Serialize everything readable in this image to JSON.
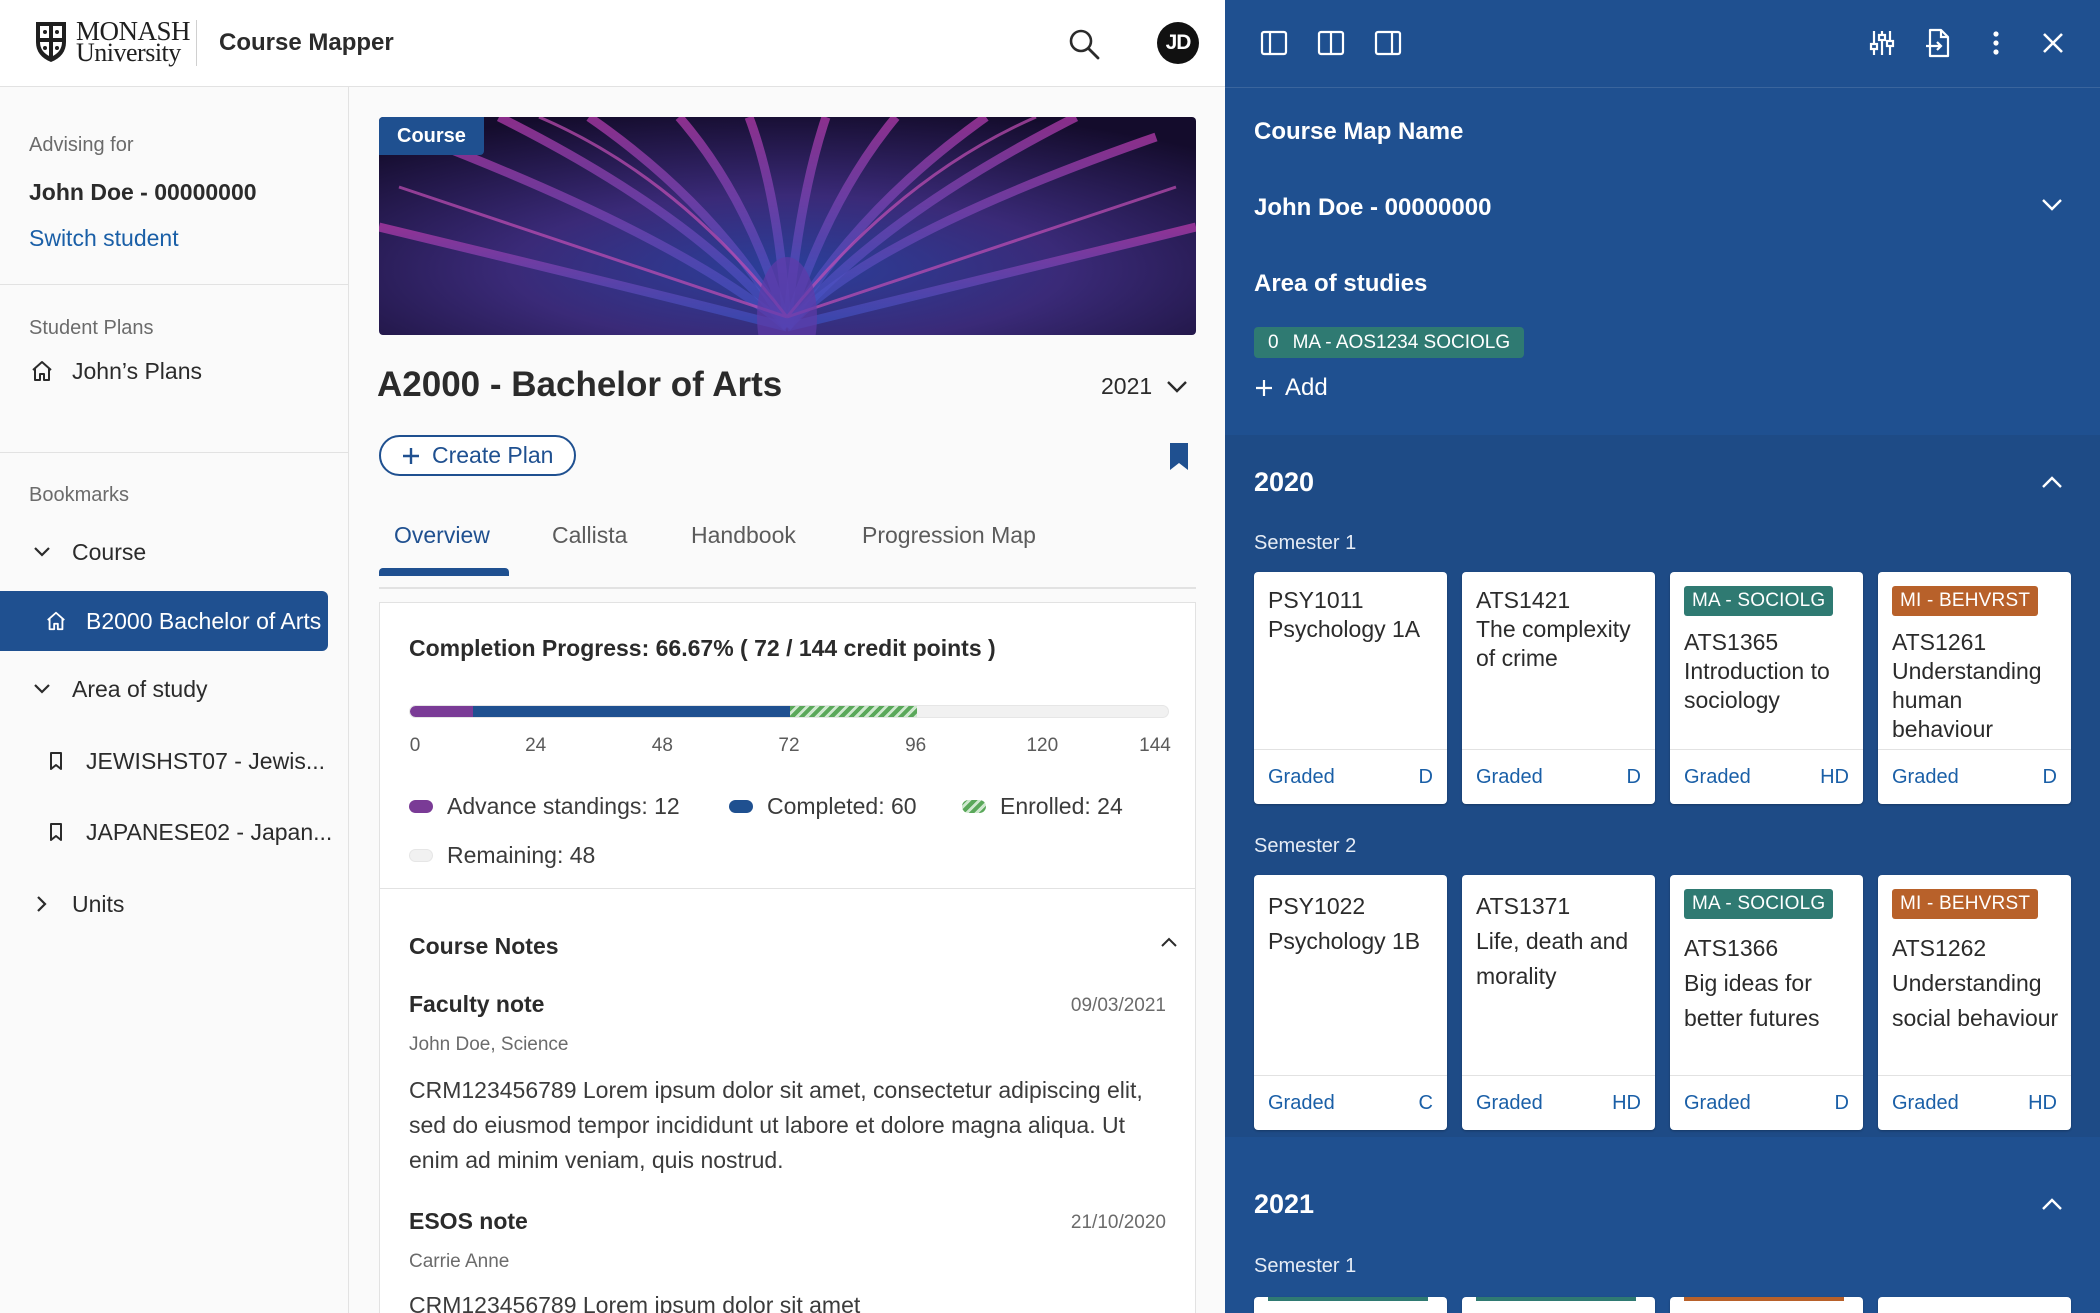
{
  "header": {
    "logo_line1": "MONASH",
    "logo_line2": "University",
    "app_title": "Course Mapper",
    "avatar_initials": "JD"
  },
  "sidebar": {
    "advising_label": "Advising for",
    "student_name": "John Doe - 00000000",
    "switch_label": "Switch student",
    "plans_label": "Student Plans",
    "plans_item": "John’s Plans",
    "bookmarks_label": "Bookmarks",
    "course_group": "Course",
    "course_item": "B2000 Bachelor of Arts",
    "aos_group": "Area of study",
    "aos_items": [
      "JEWISHST07 - Jewis...",
      "JAPANESE02 - Japan..."
    ],
    "units_group": "Units"
  },
  "main": {
    "banner_tag": "Course",
    "course_title": "A2000 - Bachelor of Arts",
    "year_value": "2021",
    "create_plan_label": "Create Plan",
    "tabs": [
      "Overview",
      "Callista",
      "Handbook",
      "Progression Map"
    ],
    "active_tab": "Overview",
    "progress": {
      "title": "Completion Progress: 66.67% ( 72  / 144 credit points )",
      "total": 144,
      "ticks": [
        "0",
        "24",
        "48",
        "72",
        "96",
        "120",
        "144"
      ],
      "segments": [
        {
          "name": "Advance standings: 12",
          "value": 12,
          "color": "#7a3b96"
        },
        {
          "name": "Completed: 60",
          "value": 60,
          "color": "#1f5090"
        },
        {
          "name": "Enrolled: 24",
          "value": 24,
          "color": "#5aa85a"
        },
        {
          "name": "Remaining: 48",
          "value": 48,
          "color": "#f1f1f1"
        }
      ]
    },
    "notes": {
      "title": "Course Notes",
      "items": [
        {
          "title": "Faculty note",
          "date": "09/03/2021",
          "author": "John Doe, Science",
          "body": "CRM123456789 Lorem ipsum dolor sit amet, consectetur adipiscing elit, sed do eiusmod tempor incididunt ut labore et dolore magna aliqua. Ut enim ad minim veniam, quis nostrud."
        },
        {
          "title": "ESOS note",
          "date": "21/10/2020",
          "author": "Carrie Anne",
          "body": "CRM123456789 Lorem ipsum dolor sit amet"
        }
      ]
    }
  },
  "panel": {
    "map_name_label": "Course Map Name",
    "student_select": "John Doe - 00000000",
    "aos_label": "Area of studies",
    "aos_chip_count": "0",
    "aos_chip_label": "MA - AOS1234 SOCIOLG",
    "add_label": "Add",
    "years": [
      {
        "year": "2020",
        "semesters": [
          {
            "label": "Semester 1",
            "units": [
              {
                "tag": "",
                "tag_color": "",
                "code": "PSY1011",
                "name": "Psychology 1A",
                "status": "Graded",
                "grade": "D"
              },
              {
                "tag": "",
                "tag_color": "",
                "code": "ATS1421",
                "name": "The complexity of crime",
                "status": "Graded",
                "grade": "D"
              },
              {
                "tag": "MA - SOCIOLG",
                "tag_color": "#2f7a72",
                "code": "ATS1365",
                "name": "Introduction to sociology",
                "status": "Graded",
                "grade": "HD"
              },
              {
                "tag": "MI - BEHVRST",
                "tag_color": "#b8612a",
                "code": "ATS1261",
                "name": "Understanding human behaviour",
                "status": "Graded",
                "grade": "D"
              }
            ]
          },
          {
            "label": "Semester 2",
            "units": [
              {
                "tag": "",
                "tag_color": "",
                "code": "PSY1022",
                "name": "Psychology 1B",
                "status": "Graded",
                "grade": "C"
              },
              {
                "tag": "",
                "tag_color": "",
                "code": "ATS1371",
                "name": "Life, death and morality",
                "status": "Graded",
                "grade": "HD"
              },
              {
                "tag": "MA - SOCIOLG",
                "tag_color": "#2f7a72",
                "code": "ATS1366",
                "name": "Big ideas for better futures",
                "status": "Graded",
                "grade": "D"
              },
              {
                "tag": "MI - BEHVRST",
                "tag_color": "#b8612a",
                "code": "ATS1262",
                "name": "Understanding social behaviour",
                "status": "Graded",
                "grade": "HD"
              }
            ]
          }
        ]
      },
      {
        "year": "2021",
        "semesters": [
          {
            "label": "Semester 1",
            "units": []
          }
        ]
      }
    ]
  }
}
